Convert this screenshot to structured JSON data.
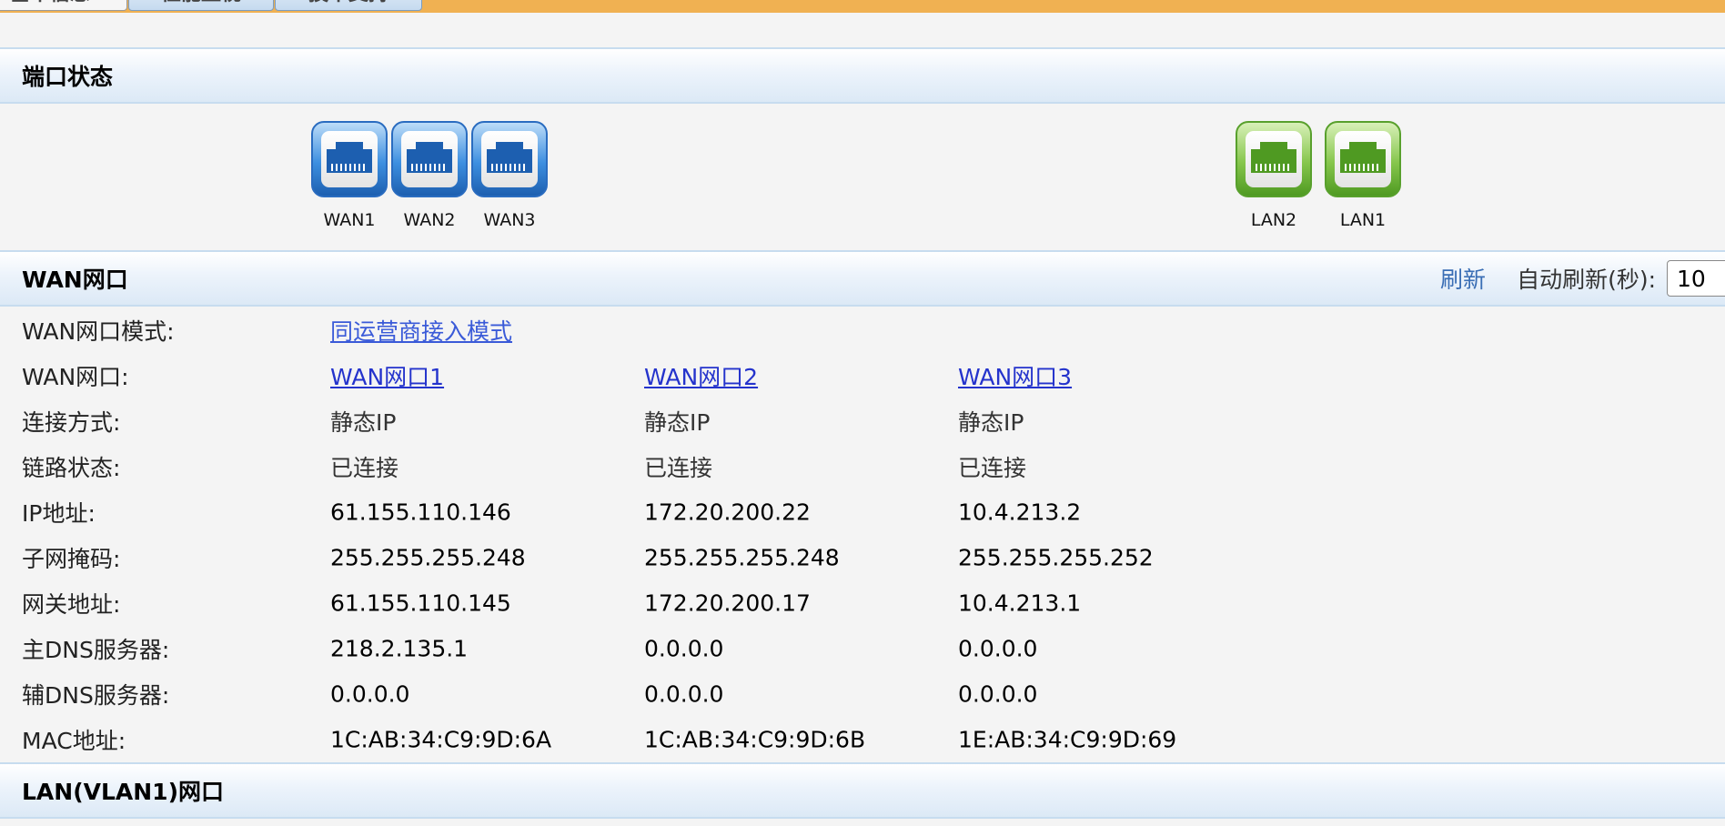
{
  "tabs": [
    {
      "label": "基本信息",
      "active": true
    },
    {
      "label": "性能监视",
      "active": false
    },
    {
      "label": "技术支持",
      "active": false
    }
  ],
  "port_status": {
    "title": "端口状态",
    "wan_ports": [
      "WAN1",
      "WAN2",
      "WAN3"
    ],
    "lan_ports": [
      "LAN2",
      "LAN1"
    ]
  },
  "wan": {
    "title": "WAN网口",
    "refresh_label": "刷新",
    "auto_refresh_label": "自动刷新(秒):",
    "auto_refresh_value": "10",
    "mode_label": "WAN网口模式:",
    "mode_value": "同运营商接入模式",
    "port_label": "WAN网口:",
    "ports": [
      "WAN网口1",
      "WAN网口2",
      "WAN网口3"
    ],
    "rows": [
      {
        "label": "连接方式:",
        "values": [
          "静态IP",
          "静态IP",
          "静态IP"
        ]
      },
      {
        "label": "链路状态:",
        "values": [
          "已连接",
          "已连接",
          "已连接"
        ]
      },
      {
        "label": "IP地址:",
        "values": [
          "61.155.110.146",
          "172.20.200.22",
          "10.4.213.2"
        ]
      },
      {
        "label": "子网掩码:",
        "values": [
          "255.255.255.248",
          "255.255.255.248",
          "255.255.255.252"
        ]
      },
      {
        "label": "网关地址:",
        "values": [
          "61.155.110.145",
          "172.20.200.17",
          "10.4.213.1"
        ]
      },
      {
        "label": "主DNS服务器:",
        "values": [
          "218.2.135.1",
          "0.0.0.0",
          "0.0.0.0"
        ]
      },
      {
        "label": "辅DNS服务器:",
        "values": [
          "0.0.0.0",
          "0.0.0.0",
          "0.0.0.0"
        ]
      },
      {
        "label": "MAC地址:",
        "values": [
          "1C:AB:34:C9:9D:6A",
          "1C:AB:34:C9:9D:6B",
          "1E:AB:34:C9:9D:69"
        ]
      }
    ]
  },
  "lan": {
    "title": "LAN(VLAN1)网口"
  },
  "icons": {
    "wan_port": "ethernet-port-blue-icon",
    "lan_port": "ethernet-port-green-icon"
  },
  "colors": {
    "tab_strip": "#f0b152",
    "wan_port": "#3d8fe0",
    "lan_port": "#86c64c",
    "link": "#2433cc"
  }
}
